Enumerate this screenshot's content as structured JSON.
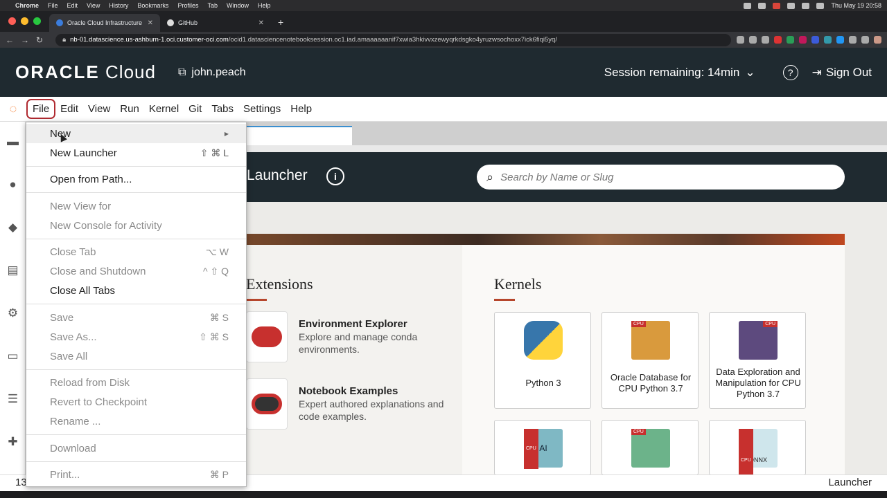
{
  "mac_menubar": {
    "app": "Chrome",
    "menus": [
      "File",
      "Edit",
      "View",
      "History",
      "Bookmarks",
      "Profiles",
      "Tab",
      "Window",
      "Help"
    ],
    "clock": "Thu May 19  20:58"
  },
  "browser": {
    "tabs": [
      {
        "title": "Oracle Cloud Infrastructure"
      },
      {
        "title": "GitHub"
      }
    ],
    "url_host": "nb-01.datascience.us-ashburn-1.oci.customer-oci.com",
    "url_path": "/ocid1.datasciencenotebooksession.oc1.iad.amaaaaaanif7xwia3hkivvxzewyqrkdsgko4yruzwsochoxx7ick6fiqi5yq/"
  },
  "oci_header": {
    "brand_bold": "ORACLE",
    "brand_light": "Cloud",
    "user": "john.peach",
    "session": "Session remaining: 14min",
    "sign_out": "Sign Out"
  },
  "jupyter_menu": [
    "File",
    "Edit",
    "View",
    "Run",
    "Kernel",
    "Git",
    "Tabs",
    "Settings",
    "Help"
  ],
  "launcher": {
    "title": "Launcher",
    "search_placeholder": "Search by Name or Slug",
    "extensions_title": "Extensions",
    "extensions": [
      {
        "name": "Environment Explorer",
        "desc": "Explore and manage conda environments."
      },
      {
        "name": "Notebook Examples",
        "desc": "Expert authored explanations and code examples."
      }
    ],
    "kernels_title": "Kernels",
    "kernels": [
      {
        "label": "Python 3"
      },
      {
        "label": "Oracle Database for CPU Python 3.7"
      },
      {
        "label": "Data Exploration and Manipulation for CPU Python 3.7"
      }
    ],
    "badge": "CPU",
    "onnx": "ONNX",
    "ai": "AI"
  },
  "file_menu": {
    "items": [
      {
        "label": "New",
        "shortcut": "",
        "disabled": false,
        "submenu": true
      },
      {
        "label": "New Launcher",
        "shortcut": "⇧ ⌘ L",
        "disabled": false
      },
      {
        "label": "Open from Path...",
        "shortcut": "",
        "disabled": false
      },
      {
        "label": "New View for",
        "shortcut": "",
        "disabled": true
      },
      {
        "label": "New Console for Activity",
        "shortcut": "",
        "disabled": true
      },
      {
        "label": "Close Tab",
        "shortcut": "⌥ W",
        "disabled": true
      },
      {
        "label": "Close and Shutdown",
        "shortcut": "^ ⇧ Q",
        "disabled": true
      },
      {
        "label": "Close All Tabs",
        "shortcut": "",
        "disabled": false
      },
      {
        "label": "Save",
        "shortcut": "⌘ S",
        "disabled": true
      },
      {
        "label": "Save As...",
        "shortcut": "⇧ ⌘ S",
        "disabled": true
      },
      {
        "label": "Save All",
        "shortcut": "",
        "disabled": true
      },
      {
        "label": "Reload from Disk",
        "shortcut": "",
        "disabled": true
      },
      {
        "label": "Revert to Checkpoint",
        "shortcut": "",
        "disabled": true
      },
      {
        "label": "Rename ...",
        "shortcut": "",
        "disabled": true
      },
      {
        "label": "Download",
        "shortcut": "",
        "disabled": true
      },
      {
        "label": "Print...",
        "shortcut": "⌘ P",
        "disabled": true
      }
    ]
  },
  "statusbar": {
    "left": "13",
    "right": "Launcher"
  },
  "colors": {
    "oracle_dark": "#1f2a30",
    "accent_red": "#b02a30",
    "jupyter_orange": "#f37726"
  }
}
